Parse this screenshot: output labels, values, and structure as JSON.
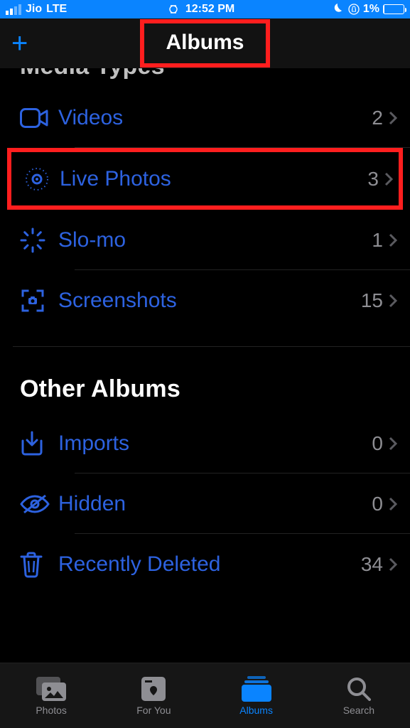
{
  "status": {
    "carrier": "Jio",
    "network": "LTE",
    "time": "12:52 PM",
    "battery_pct": "1%"
  },
  "nav": {
    "title": "Albums"
  },
  "sections": {
    "media_types": {
      "header": "Media Types",
      "items": [
        {
          "id": "videos",
          "label": "Videos",
          "count": "2",
          "icon": "videos-icon"
        },
        {
          "id": "live-photos",
          "label": "Live Photos",
          "count": "3",
          "icon": "live-photos-icon",
          "highlighted": true
        },
        {
          "id": "slo-mo",
          "label": "Slo-mo",
          "count": "1",
          "icon": "slomo-icon"
        },
        {
          "id": "screenshots",
          "label": "Screenshots",
          "count": "15",
          "icon": "screenshots-icon"
        }
      ]
    },
    "other_albums": {
      "header": "Other Albums",
      "items": [
        {
          "id": "imports",
          "label": "Imports",
          "count": "0",
          "icon": "imports-icon"
        },
        {
          "id": "hidden",
          "label": "Hidden",
          "count": "0",
          "icon": "hidden-icon"
        },
        {
          "id": "recently-deleted",
          "label": "Recently Deleted",
          "count": "34",
          "icon": "trash-icon"
        }
      ]
    }
  },
  "tabs": [
    {
      "id": "photos",
      "label": "Photos",
      "active": false
    },
    {
      "id": "for-you",
      "label": "For You",
      "active": false
    },
    {
      "id": "albums",
      "label": "Albums",
      "active": true
    },
    {
      "id": "search",
      "label": "Search",
      "active": false
    }
  ],
  "colors": {
    "accent": "#0a84ff",
    "link": "#2d62e0",
    "annotation": "#ff1e1e"
  }
}
